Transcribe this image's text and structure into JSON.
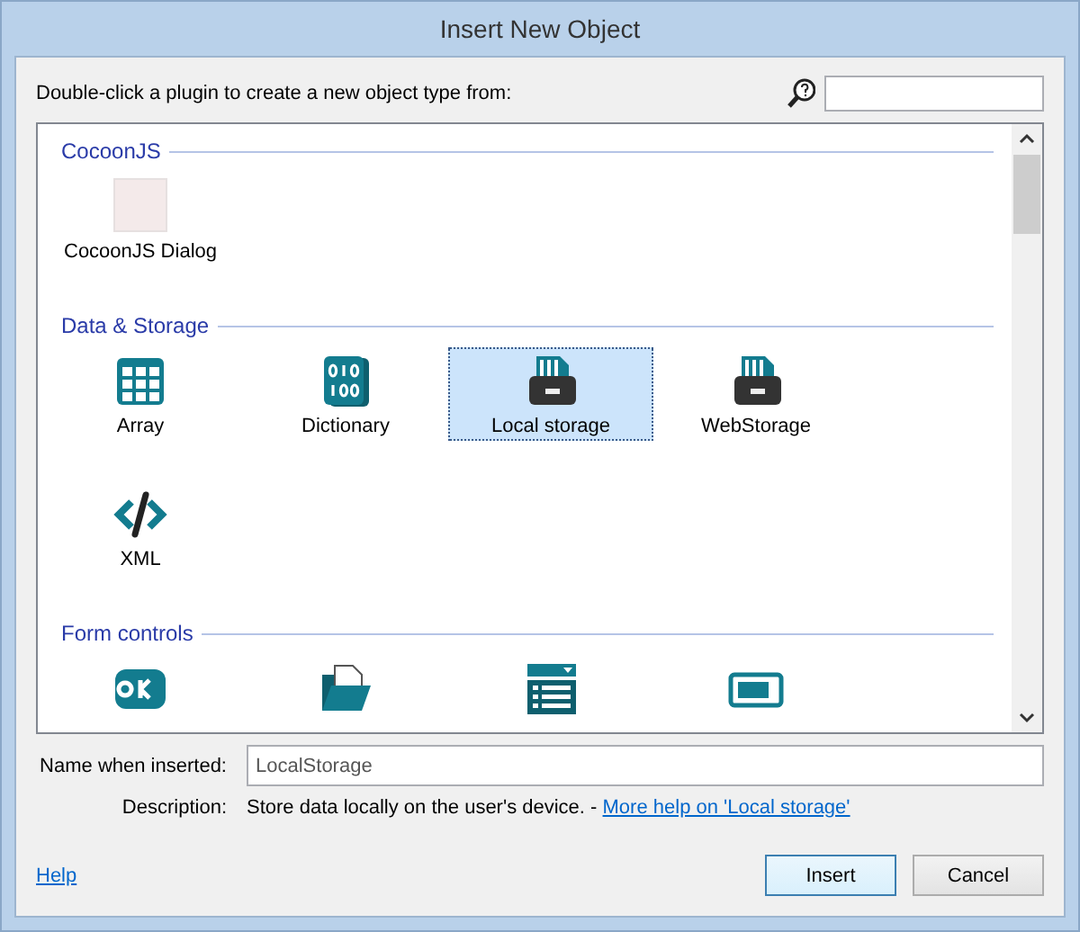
{
  "window": {
    "title": "Insert New Object"
  },
  "prompt": "Double-click a plugin to create a new object type from:",
  "sections": [
    {
      "title": "CocoonJS",
      "items": [
        {
          "kind": "photo",
          "label": "CocoonJS Dialog",
          "selected": false
        }
      ]
    },
    {
      "title": "Data & Storage",
      "items": [
        {
          "kind": "grid",
          "label": "Array",
          "selected": false
        },
        {
          "kind": "binary",
          "label": "Dictionary",
          "selected": false
        },
        {
          "kind": "storage",
          "label": "Local storage",
          "selected": true
        },
        {
          "kind": "storage",
          "label": "WebStorage",
          "selected": false
        },
        {
          "kind": "code",
          "label": "XML",
          "selected": false
        }
      ]
    },
    {
      "title": "Form controls",
      "items": [
        {
          "kind": "ok",
          "selected": false
        },
        {
          "kind": "folder",
          "selected": false
        },
        {
          "kind": "list",
          "selected": false
        },
        {
          "kind": "progress",
          "selected": false
        }
      ]
    }
  ],
  "name_field": {
    "label": "Name when inserted:",
    "value": "LocalStorage"
  },
  "description": {
    "label": "Description:",
    "text": "Store data locally on the user's device. - ",
    "link": "More help on 'Local storage'"
  },
  "help_link": "Help",
  "buttons": [
    {
      "label": "Insert",
      "default": true
    },
    {
      "label": "Cancel",
      "default": false
    }
  ]
}
